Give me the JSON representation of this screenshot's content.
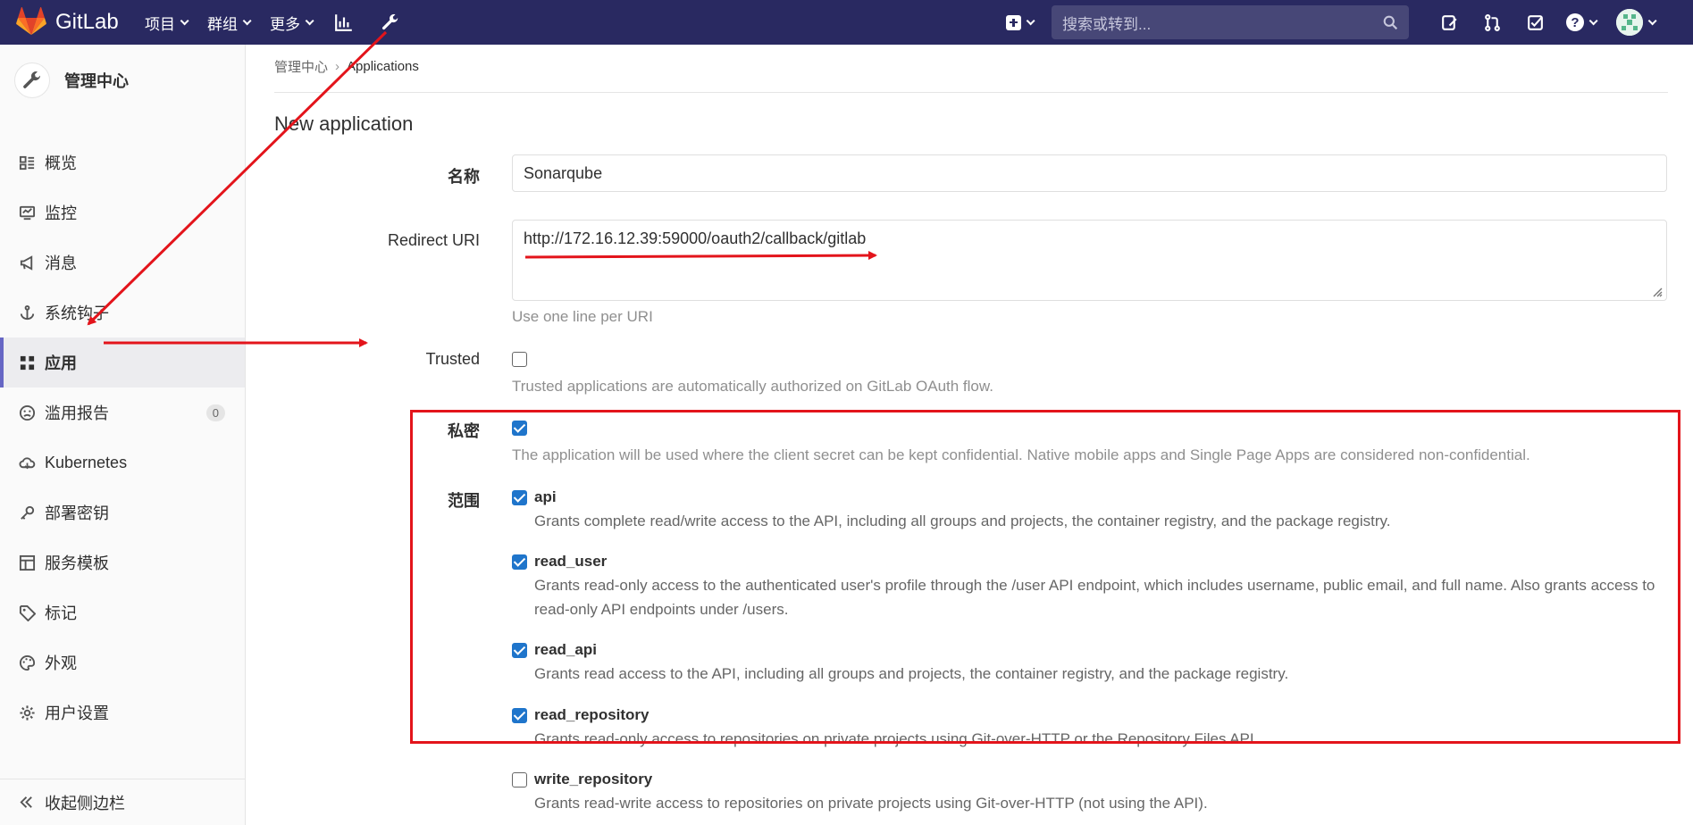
{
  "navbar": {
    "brand": "GitLab",
    "menu": [
      {
        "label": "项目"
      },
      {
        "label": "群组"
      },
      {
        "label": "更多"
      }
    ],
    "search_placeholder": "搜索或转到..."
  },
  "sidebar": {
    "title": "管理中心",
    "items": [
      {
        "label": "概览",
        "icon": "overview-icon"
      },
      {
        "label": "监控",
        "icon": "monitor-icon"
      },
      {
        "label": "消息",
        "icon": "messages-icon"
      },
      {
        "label": "系统钩子",
        "icon": "anchor-icon"
      },
      {
        "label": "应用",
        "icon": "apps-icon",
        "active": true
      },
      {
        "label": "滥用报告",
        "icon": "abuse-icon",
        "badge": "0"
      },
      {
        "label": "Kubernetes",
        "icon": "cloud-icon"
      },
      {
        "label": "部署密钥",
        "icon": "key-icon"
      },
      {
        "label": "服务模板",
        "icon": "template-icon"
      },
      {
        "label": "标记",
        "icon": "tag-icon"
      },
      {
        "label": "外观",
        "icon": "palette-icon"
      },
      {
        "label": "用户设置",
        "icon": "settings-icon"
      }
    ],
    "collapse_label": "收起侧边栏"
  },
  "breadcrumb": {
    "parent": "管理中心",
    "current": "Applications"
  },
  "page": {
    "title": "New application"
  },
  "form": {
    "name_label": "名称",
    "name_value": "Sonarqube",
    "redirect_label": "Redirect URI",
    "redirect_value": "http://172.16.12.39:59000/oauth2/callback/gitlab",
    "redirect_help": "Use one line per URI",
    "trusted_label": "Trusted",
    "trusted_checked": false,
    "trusted_help": "Trusted applications are automatically authorized on GitLab OAuth flow.",
    "confidential_label": "私密",
    "confidential_checked": true,
    "confidential_help": "The application will be used where the client secret can be kept confidential. Native mobile apps and Single Page Apps are considered non-confidential.",
    "scopes_label": "范围",
    "scopes": [
      {
        "name": "api",
        "checked": true,
        "desc": "Grants complete read/write access to the API, including all groups and projects, the container registry, and the package registry."
      },
      {
        "name": "read_user",
        "checked": true,
        "desc": "Grants read-only access to the authenticated user's profile through the /user API endpoint, which includes username, public email, and full name. Also grants access to read-only API endpoints under /users."
      },
      {
        "name": "read_api",
        "checked": true,
        "desc": "Grants read access to the API, including all groups and projects, the container registry, and the package registry."
      },
      {
        "name": "read_repository",
        "checked": true,
        "desc": "Grants read-only access to repositories on private projects using Git-over-HTTP or the Repository Files API."
      },
      {
        "name": "write_repository",
        "checked": false,
        "desc": "Grants read-write access to repositories on private projects using Git-over-HTTP (not using the API)."
      }
    ]
  },
  "colors": {
    "navbar": "#292961",
    "checkbox": "#1f75cb",
    "annotation": "#e3141b",
    "active_indicator": "#6666c4"
  }
}
